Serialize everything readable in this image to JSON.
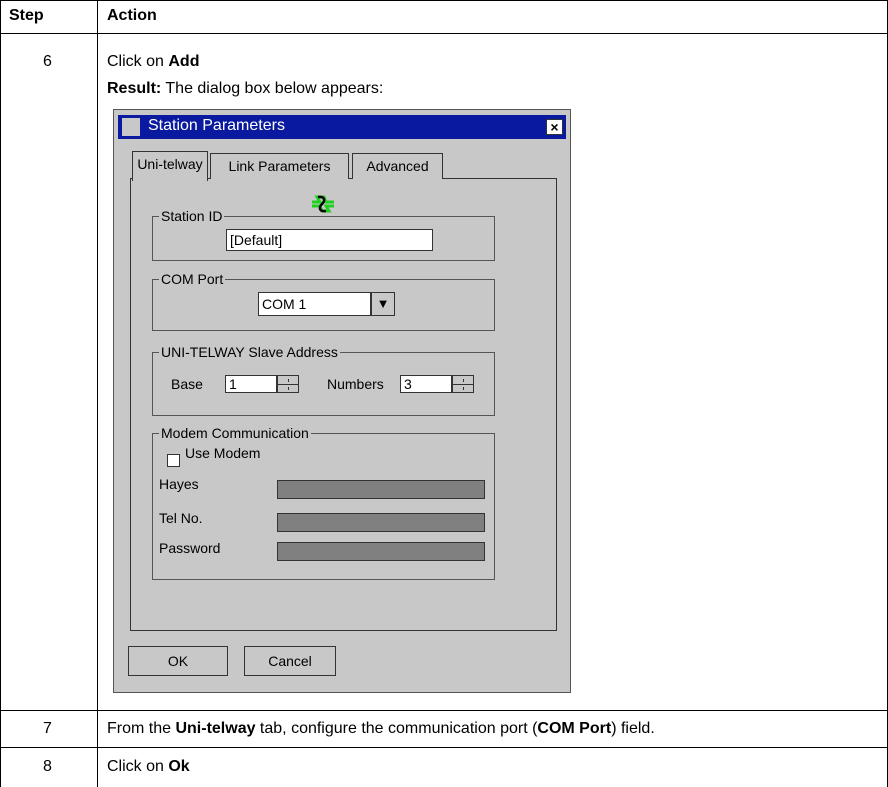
{
  "table": {
    "headers": {
      "step": "Step",
      "action": "Action"
    },
    "rows": [
      {
        "step": "6",
        "line1_pre": "Click on ",
        "line1_bold": "Add",
        "line2_bold": "Result:",
        "line2_rest": " The dialog box below appears:"
      },
      {
        "step": "7",
        "p1": "From the ",
        "b1": "Uni-telway",
        "p2": " tab, configure the communication port (",
        "b2": "COM Port",
        "p3": ") field."
      },
      {
        "step": "8",
        "p1": "Click on ",
        "b1": "Ok"
      }
    ]
  },
  "dialog": {
    "title": "Station Parameters",
    "close": "×",
    "tabs": [
      "Uni-telway",
      "Link Parameters",
      "Advanced"
    ],
    "station_id": {
      "legend": "Station ID",
      "value": "[Default]"
    },
    "com_port": {
      "legend": "COM Port",
      "value": "COM 1",
      "arrow": "▼"
    },
    "slave_address": {
      "legend": "UNI-TELWAY Slave Address",
      "base_label": "Base",
      "base_value": "1",
      "numbers_label": "Numbers",
      "numbers_value": "3"
    },
    "modem": {
      "legend": "Modem Communication",
      "use_modem": "Use Modem",
      "hayes": "Hayes",
      "tel": "Tel No.",
      "password": "Password"
    },
    "buttons": {
      "ok": "OK",
      "cancel": "Cancel"
    }
  },
  "colors": {
    "titlebar": "#0a1aa0",
    "dialog_bg": "#c8c8c8",
    "icon": "#1fd11f"
  }
}
